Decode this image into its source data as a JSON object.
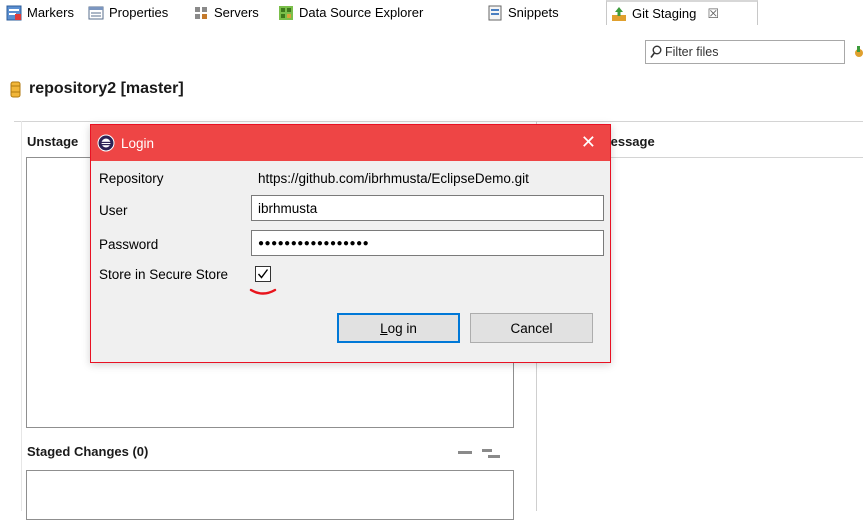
{
  "tabs": [
    {
      "label": "Markers",
      "icon": "markers-icon"
    },
    {
      "label": "Properties",
      "icon": "properties-icon"
    },
    {
      "label": "Servers",
      "icon": "servers-icon"
    },
    {
      "label": "Data Source Explorer",
      "icon": "data-source-explorer-icon"
    },
    {
      "label": "Snippets",
      "icon": "snippets-icon"
    },
    {
      "label": "Git Staging",
      "icon": "git-staging-icon",
      "close": "☒"
    }
  ],
  "filter": {
    "placeholder": "Filter files"
  },
  "repository": {
    "title": "repository2 [master]"
  },
  "sections": {
    "unstaged_label": "Unstage",
    "message_label": "lessage",
    "staged_label": "Staged Changes (0)"
  },
  "dialog": {
    "title": "Login",
    "close": "✕",
    "repository_label": "Repository",
    "repository_value": "https://github.com/ibrhmusta/EclipseDemo.git",
    "user_label": "User",
    "user_value": "ibrhmusta",
    "password_label": "Password",
    "password_value": "●●●●●●●●●●●●●●●●●",
    "store_label": "Store in Secure Store",
    "store_checked": true,
    "login_button_prefix": "L",
    "login_button_rest": "og in",
    "cancel_button": "Cancel"
  },
  "colors": {
    "titlebar": "#ee4545",
    "dialog_border": "#e81123",
    "button_focus": "#0078d7",
    "annotation": "#e8141c"
  }
}
